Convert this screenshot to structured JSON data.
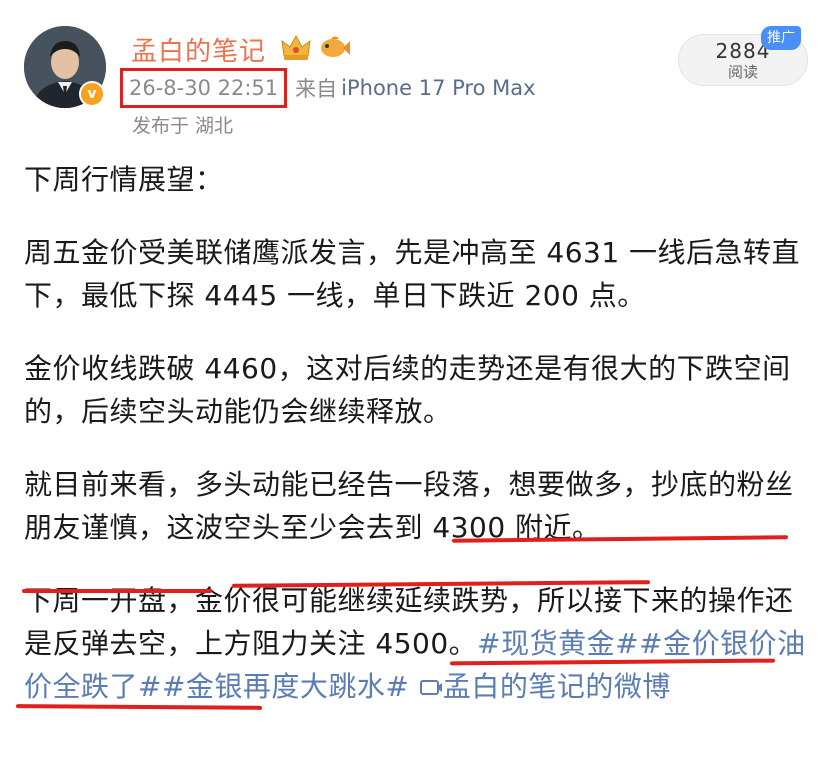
{
  "user": {
    "name": "孟白的笔记",
    "verified_mark": "v",
    "badges": [
      "crown-badge-icon",
      "fish-badge-icon"
    ]
  },
  "meta": {
    "timestamp": "26-8-30 22:51",
    "from_label": "来自",
    "device": "iPhone 17 Pro Max",
    "location": "发布于 湖北"
  },
  "stats": {
    "read_count": "2884",
    "read_label": "阅读",
    "promo_label": "推广"
  },
  "post": {
    "p1": "下周行情展望：",
    "p2": "周五金价受美联储鹰派发言，先是冲高至 4631 一线后急转直下，最低下探 4445 一线，单日下跌近 200 点。",
    "p3": "金价收线跌破 4460，这对后续的走势还是有很大的下跌空间的，后续空头动能仍会继续释放。",
    "p4": "就目前来看，多头动能已经告一段落，想要做多，抄底的粉丝朋友谨慎，这波空头至少会去到 4300 附近。",
    "p5_text": "下周一开盘，金价很可能继续延续跌势，所以接下来的操作还是反弹去空，上方阻力关注 4500。",
    "tag1": "#现货黄金#",
    "tag2": "#金价银价油价全跌了#",
    "tag3": "#金银再度大跳水#",
    "link_icon": "link-icon",
    "link_text": "孟白的笔记的微博"
  },
  "accent": {
    "name_color": "#eb7350",
    "link_color": "#5b7cb4",
    "annotation_red": "#e0201c"
  }
}
